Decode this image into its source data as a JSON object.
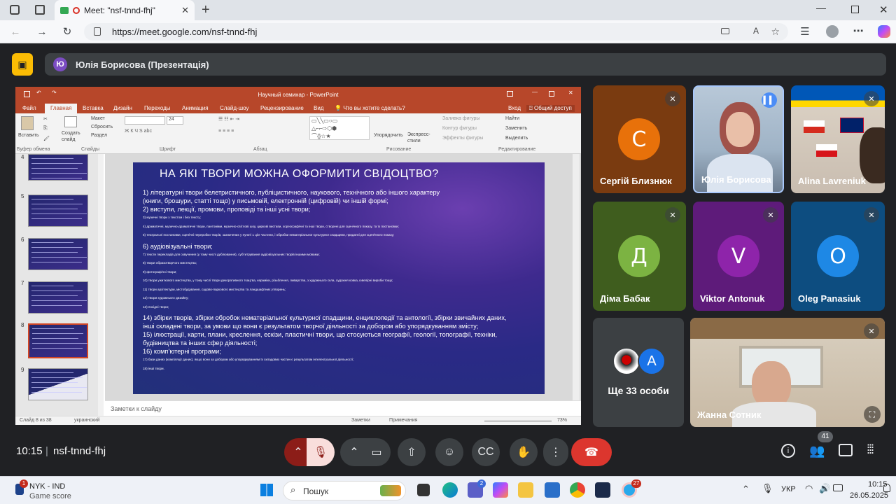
{
  "browser": {
    "tab_title": "Meet: \"nsf-tnnd-fhj\"",
    "url": "https://meet.google.com/nsf-tnnd-fhj"
  },
  "meet": {
    "presenter_initial": "Ю",
    "presenter_label": "Юлія Борисова (Презентація)",
    "time": "10:15",
    "meeting_code": "nsf-tnnd-fhj",
    "participant_count": "41",
    "participants": [
      {
        "name": "Сергій Близнюк",
        "initial": "С",
        "color": "#e8710a"
      },
      {
        "name": "Юлія Борисова"
      },
      {
        "name": "Alina Lavreniuk"
      },
      {
        "name": "Діма Бабак",
        "initial": "Д",
        "color": "#7cb342"
      },
      {
        "name": "Viktor Antonuk",
        "initial": "V",
        "color": "#8e24aa"
      },
      {
        "name": "Oleg Panasiuk",
        "initial": "O",
        "color": "#1e88e5"
      }
    ],
    "others_label": "Ще 33 особи",
    "others_avatar_initial": "A",
    "bottom_tile_name": "Жанна Сотник"
  },
  "ppt": {
    "window_title": "Научный семинар - PowerPoint",
    "tabs": [
      "Файл",
      "Главная",
      "Вставка",
      "Дизайн",
      "Переходы",
      "Анимация",
      "Слайд-шоу",
      "Рецензирование",
      "Вид"
    ],
    "tellme": "Что вы хотите сделать?",
    "signin": "Вход",
    "share": "Общий доступ",
    "ribbon": {
      "paste": "Вставить",
      "clipboard": "Буфер обмена",
      "create_slide": "Создать слайд",
      "layout": "Макет",
      "reset": "Сбросить",
      "section": "Раздел",
      "slides": "Слайды",
      "font": "Шрифт",
      "font_size": "24",
      "paragraph": "Абзац",
      "arrange": "Упорядочить",
      "express_styles": "Экспресс-стили",
      "fill": "Заливка фигуры",
      "outline": "Контур фигуры",
      "effects": "Эффекты фигуры",
      "drawing": "Рисование",
      "find": "Найти",
      "replace": "Заменить",
      "select": "Выделить",
      "editing": "Редактирование"
    },
    "thumb_numbers": [
      "4",
      "5",
      "6",
      "7",
      "8",
      "9"
    ],
    "notes_placeholder": "Заметки к слайду",
    "status_slide": "Слайд 8 из 38",
    "status_lang": "украинский",
    "status_notes": "Заметки",
    "status_comments": "Примечания",
    "zoom": "73%"
  },
  "slide": {
    "title": "НА ЯКІ ТВОРИ МОЖНА ОФОРМИТИ СВІДОЦТВО?",
    "lines": [
      {
        "text": "1) літературні твори белетристичного, публіцистичного, наукового, технічного або іншого характеру",
        "size": "lg"
      },
      {
        "text": "(книги, брошури, статті тощо) у письмовій, електронній (цифровій) чи іншій формі;",
        "size": "lg"
      },
      {
        "text": "2) виступи, лекції, промови, проповіді та інші усні твори;",
        "size": "lg"
      },
      {
        "text": "3) музичні твори з текстом і без тексту;",
        "size": "sm"
      },
      {
        "text": "4) драматичні, музично-драматичні твори, пантоміми, музично-світлові шоу, циркові вистави, хореографічні та інші твори, створені для сценічного показу, та їх постановки;",
        "size": "sm"
      },
      {
        "text": "5) театральні постановки, сценічні переробки творів, зазначених у пункті 1 цієї частини, і обробки нематеріальної культурної спадщини, придатні для сценічного показу;",
        "size": "sm"
      },
      {
        "text": "6) аудіовізуальні твори;",
        "size": "lg"
      },
      {
        "text": "7) тексти перекладів для озвучення (у тому числі дублювання), субтитрування аудіовізуальних творів іншими мовами;",
        "size": "sm"
      },
      {
        "text": "8) твори образотворчого мистецтва;",
        "size": "sm"
      },
      {
        "text": "9) фотографічні твори;",
        "size": "sm"
      },
      {
        "text": "10) твори ужиткового мистецтва, у тому числі твори декоративного ткацтва, кераміки, різьблення, ливарства, з художнього скла, художня ковка, ювелірні вироби тощо;",
        "size": "sm"
      },
      {
        "text": "11) твори архітектури, містобудування, садово-паркового мистецтва та ландшафтних утворень;",
        "size": "sm"
      },
      {
        "text": "12) твори художнього дизайну;",
        "size": "sm"
      },
      {
        "text": "13) похідні твори;",
        "size": "sm"
      },
      {
        "text": "14) збірки творів, збірки обробок нематеріальної культурної спадщини, енциклопедії та антології, збірки звичайних даних,",
        "size": "lg"
      },
      {
        "text": "інші складені твори, за умови що вони є результатом творчої діяльності за добором або упорядкуванням змісту;",
        "size": "lg"
      },
      {
        "text": "15) ілюстрації, карти, плани, креслення, ескізи, пластичні твори, що стосуються географії, геології, топографії, техніки,",
        "size": "lg"
      },
      {
        "text": "будівництва та інших сфер діяльності;",
        "size": "lg"
      },
      {
        "text": "16) комп’ютерні програми;",
        "size": "lg"
      },
      {
        "text": "17) бази даних (компіляції даних), якщо вони за добором або упорядкуванням їх складових частин є результатом інтелектуальної діяльності;",
        "size": "sm"
      },
      {
        "text": "18) інші твори.",
        "size": "sm"
      }
    ]
  },
  "taskbar": {
    "weather_title": "NYK - IND",
    "weather_sub": "Game score",
    "weather_badge": "1",
    "search": "Пошук",
    "lang": "УКР",
    "time": "10:15",
    "date": "26.05.2025",
    "teams_badge": "2",
    "telegram_badge": "27"
  }
}
